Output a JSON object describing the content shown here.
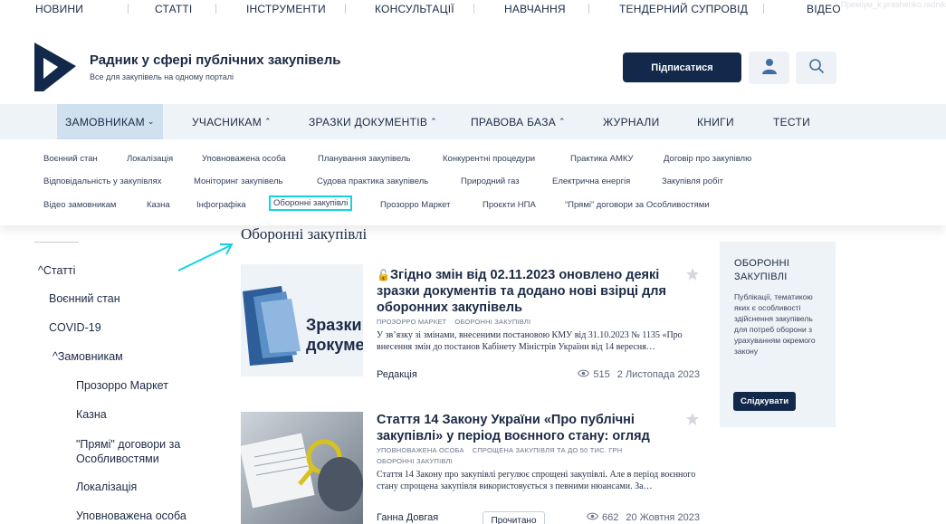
{
  "top_nav": {
    "items": [
      "НОВИНИ",
      "СТАТТІ",
      "ІНСТРУМЕНТИ",
      "КОНСУЛЬТАЦІЇ",
      "НАВЧАННЯ",
      "ТЕНДЕРНИЙ СУПРОВІД",
      "ВІДЕО"
    ],
    "watermark": "Преміум_k.prashenko.radnik"
  },
  "header": {
    "title": "Радник у сфері публічних закупівель",
    "subtitle": "Все для закупівель на одному порталі",
    "subscribe_label": "Підписатися",
    "user_icon": "user-icon",
    "search_icon": "search-icon",
    "brand_color": "#13294b"
  },
  "main_menu": {
    "items": [
      "ЗАМОВНИКАМ",
      "УЧАСНИКАМ",
      "ЗРАЗКИ ДОКУМЕНТІВ",
      "ПРАВОВА БАЗА",
      "ЖУРНАЛИ",
      "КНИГИ",
      "ТЕСТИ"
    ],
    "active": "ЗАМОВНИКАМ"
  },
  "submenu": {
    "row1": [
      "Воєнний стан",
      "Локалізація",
      "Уповноважена особа",
      "Планування закупівель",
      "Конкурентні процедури",
      "Практика АМКУ",
      "Договір про закупівлю"
    ],
    "row2": [
      "Відповідальність у закупівлях",
      "Моніторинг закупівель",
      "Судова практика закупівель",
      "Природний газ",
      "Електрична енергія",
      "Закупівля робіт"
    ],
    "row3": [
      "Відео замовникам",
      "Казна",
      "Інфографіка",
      "Оборонні закупівлі",
      "Прозорро Маркет",
      "Проєкти НПА",
      "“Прямі” договори за Особливостями"
    ],
    "highlighted": "Оборонні закупівлі",
    "highlight_color": "#12d3e6"
  },
  "sidebar": {
    "root": "Статті",
    "items": [
      "Воєнний стан",
      "COVID-19"
    ],
    "group": "Замовникам",
    "sub_items": [
      "Прозорро Маркет",
      "Казна",
      "\"Прямі\" договори за Особливостями",
      "Локалізація",
      "Уповноважена особа"
    ]
  },
  "page": {
    "heading": "Оборонні закупівлі"
  },
  "articles": [
    {
      "title": "Згідно змін від 02.11.2023 оновлено деякі зразки документів та додано нові взірці для оборонних закупівель",
      "tags": [
        "Прозорро Маркет",
        "Оборонні закупівлі"
      ],
      "excerpt": "У зв’язку зі змінами, внесеними постановою КМУ від 31.10.2023 № 1135 «Про внесення змін до постанов Кабінету Міністрів України від 14 вересня…",
      "author": "Редакція",
      "views": "515",
      "date": "2 Листопада 2023",
      "thumb_text": "Зразки докуме",
      "locked": true
    },
    {
      "title": "Стаття 14 Закону України «Про публічні закупівлі» у період воєнного стану: огляд",
      "tags": [
        "Уповноважена особа",
        "Спрощена закупівля та до 50 тис. грн"
      ],
      "tags2": [
        "Оборонні закупівлі"
      ],
      "excerpt": "Стаття 14 Закону про закупівлі регулює спрощені закупівлі. Але в період воєнного стану спрощена закупівля використовується з певними нюансами.   За…",
      "author": "Ганна Довгая",
      "read_label": "Прочитано",
      "views": "662",
      "date": "20 Жовтня 2023"
    }
  ],
  "right_box": {
    "title": "ОБОРОННІ ЗАКУПІВЛІ",
    "description": "Публікації, тематикою яких є особливості здійснення закупівель для потреб оборони з урахуванням окремого закону",
    "button": "Слідкувати"
  }
}
